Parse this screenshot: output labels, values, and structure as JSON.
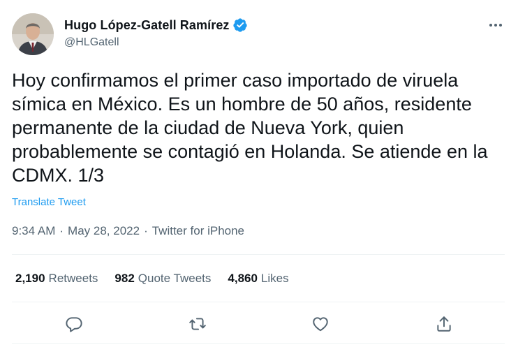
{
  "author": {
    "display_name": "Hugo López-Gatell Ramírez",
    "handle": "@HLGatell",
    "verified": true
  },
  "tweet": {
    "text": "Hoy confirmamos el primer caso importado de viruela símica en México. Es un hombre de 50 años, residente permanente de la ciudad de Nueva York, quien probablemente se contagió en Holanda. Se atiende en la CDMX. 1/3",
    "translate_label": "Translate Tweet"
  },
  "meta": {
    "time": "9:34 AM",
    "separator": "·",
    "date": "May 28, 2022",
    "source": "Twitter for iPhone"
  },
  "stats": {
    "retweets_count": "2,190",
    "retweets_label": "Retweets",
    "quote_count": "982",
    "quote_label": "Quote Tweets",
    "likes_count": "4,860",
    "likes_label": "Likes"
  },
  "colors": {
    "accent": "#1d9bf0",
    "text": "#0f1419",
    "secondary": "#536471",
    "divider": "#eff3f4"
  },
  "icons": {
    "more": "more-icon",
    "verified": "verified-badge-icon",
    "reply": "reply-icon",
    "retweet": "retweet-icon",
    "like": "heart-icon",
    "share": "share-icon"
  }
}
